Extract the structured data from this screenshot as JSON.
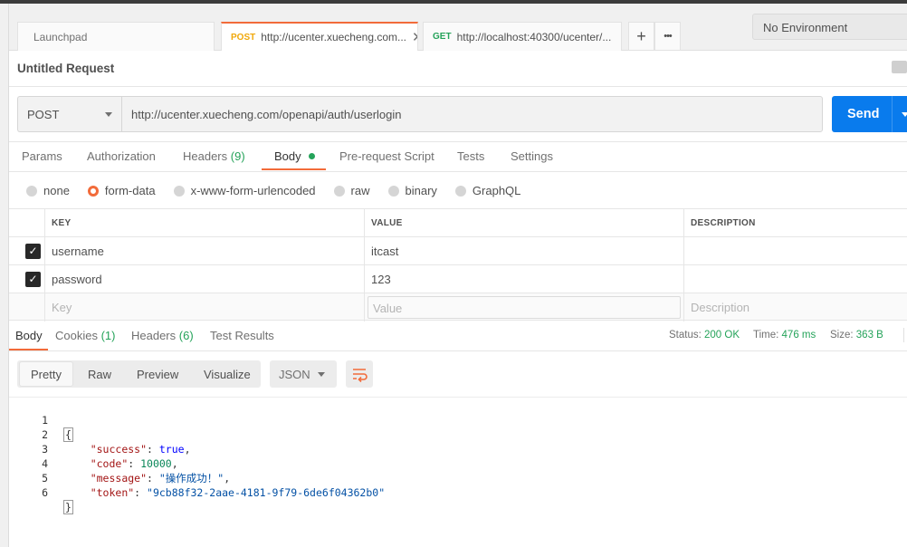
{
  "tabs": [
    {
      "label": "Launchpad"
    },
    {
      "method": "POST",
      "url": "http://ucenter.xuecheng.com...",
      "close": "✕"
    },
    {
      "method": "GET",
      "url": "http://localhost:40300/ucenter/..."
    }
  ],
  "tab_controls": {
    "add": "+",
    "more": "•••"
  },
  "environment": "No Environment",
  "request": {
    "title": "Untitled Request",
    "method": "POST",
    "url": "http://ucenter.xuecheng.com/openapi/auth/userlogin",
    "send_label": "Send"
  },
  "request_tabs": {
    "params": "Params",
    "authorization": "Authorization",
    "headers": "Headers",
    "headers_count": "(9)",
    "body": "Body",
    "prerequest": "Pre-request Script",
    "tests": "Tests",
    "settings": "Settings"
  },
  "body_types": [
    "none",
    "form-data",
    "x-www-form-urlencoded",
    "raw",
    "binary",
    "GraphQL"
  ],
  "body_type_selected": "form-data",
  "params_table": {
    "headers": {
      "key": "KEY",
      "value": "VALUE",
      "description": "DESCRIPTION"
    },
    "rows": [
      {
        "key": "username",
        "value": "itcast",
        "checked": true
      },
      {
        "key": "password",
        "value": "123",
        "checked": true
      }
    ],
    "placeholders": {
      "key": "Key",
      "value": "Value",
      "description": "Description"
    }
  },
  "response_tabs": {
    "body": "Body",
    "cookies": "Cookies",
    "cookies_count": "(1)",
    "headers": "Headers",
    "headers_count": "(6)",
    "test_results": "Test Results"
  },
  "response_status": {
    "status_label": "Status:",
    "status": "200 OK",
    "time_label": "Time:",
    "time": "476 ms",
    "size_label": "Size:",
    "size": "363 B"
  },
  "format_buttons": {
    "pretty": "Pretty",
    "raw": "Raw",
    "preview": "Preview",
    "visualize": "Visualize"
  },
  "format_select": "JSON",
  "code": {
    "line_numbers": [
      "1",
      "2",
      "3",
      "4",
      "5",
      "6"
    ],
    "open_brace": "{",
    "close_brace": "}",
    "success_key": "\"success\"",
    "success_val": "true",
    "code_key": "\"code\"",
    "code_val": "10000",
    "message_key": "\"message\"",
    "message_val": "\"操作成功！\"",
    "token_key": "\"token\"",
    "token_val": "\"9cb88f32-2aae-4181-9f79-6de6f04362b0\""
  },
  "colors": {
    "accent": "#f26b3a",
    "send_button": "#097bed",
    "status_ok": "#25a35a",
    "method_post": "#f0a80b",
    "method_get": "#25a35a"
  }
}
